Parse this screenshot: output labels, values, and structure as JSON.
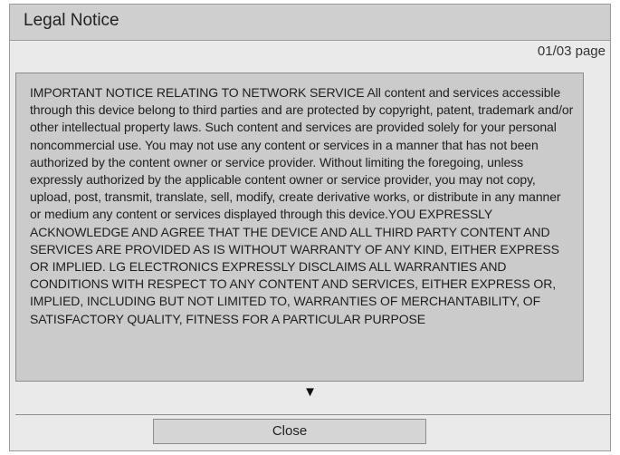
{
  "dialog": {
    "title": "Legal Notice",
    "page_indicator": "01/03 page",
    "body_text": "IMPORTANT NOTICE RELATING TO NETWORK SERVICE All content and services accessible through this device belong to third parties and are protected by copyright, patent, trademark and/or other intellectual property laws. Such content and services are provided solely for your personal noncommercial use. You may not use any content or services in a manner that has not been authorized by the content owner or service provider. Without limiting the foregoing, unless expressly authorized by the applicable content owner or service provider, you may not copy, upload, post, transmit, translate, sell, modify, create derivative works, or distribute in any manner or medium any content or services displayed through this device.YOU EXPRESSLY ACKNOWLEDGE AND AGREE THAT THE DEVICE AND ALL THIRD PARTY CONTENT AND SERVICES ARE PROVIDED AS IS WITHOUT WARRANTY OF ANY KIND, EITHER EXPRESS OR IMPLIED. LG ELECTRONICS EXPRESSLY DISCLAIMS ALL WARRANTIES AND CONDITIONS WITH RESPECT TO ANY CONTENT AND SERVICES, EITHER EXPRESS OR, IMPLIED, INCLUDING BUT NOT LIMITED TO, WARRANTIES OF MERCHANTABILITY, OF SATISFACTORY QUALITY, FITNESS FOR A PARTICULAR PURPOSE",
    "scroll_arrow": "▼",
    "close_label": "Close"
  },
  "icons": {
    "scroll_arrow": "scroll-down-arrow-icon"
  },
  "colors": {
    "titlebar": "#cfcfcf",
    "dialog_background": "#eaeaea",
    "notice_box": "#cbcbcb",
    "button": "#d5d5d5"
  }
}
